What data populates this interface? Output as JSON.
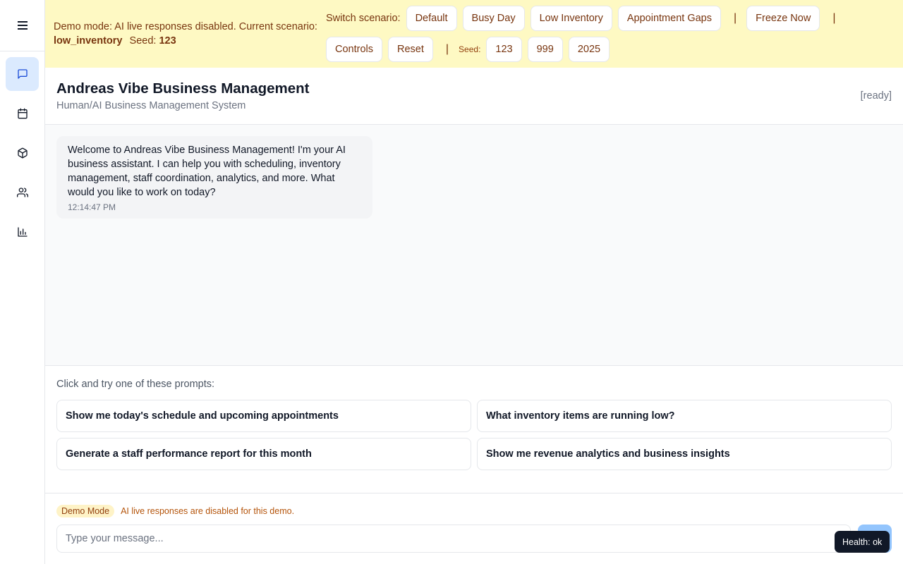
{
  "sidebar": {
    "items": [
      {
        "name": "chat",
        "icon": "message-square-icon",
        "active": true
      },
      {
        "name": "calendar",
        "icon": "calendar-icon",
        "active": false
      },
      {
        "name": "inventory",
        "icon": "package-icon",
        "active": false
      },
      {
        "name": "staff",
        "icon": "users-icon",
        "active": false
      },
      {
        "name": "analytics",
        "icon": "bar-chart-icon",
        "active": false
      }
    ],
    "menu_icon": "menu-icon"
  },
  "banner": {
    "message": "Demo mode: AI live responses disabled. Current scenario:",
    "scenario": "low_inventory",
    "seed_label": "Seed:",
    "seed_value": "123",
    "switch_label": "Switch scenario:",
    "scenarios": [
      "Default",
      "Busy Day",
      "Low Inventory",
      "Appointment Gaps"
    ],
    "freeze_label": "Freeze Now",
    "controls_label": "Controls",
    "reset_label": "Reset",
    "separator": "|",
    "seed_small_label": "Seed:",
    "seeds": [
      "123",
      "999",
      "2025"
    ]
  },
  "header": {
    "title": "Andreas Vibe Business Management",
    "subtitle": "Human/AI Business Management System",
    "status": "[ready]"
  },
  "chat": {
    "messages": [
      {
        "text": "Welcome to Andreas Vibe Business Management! I'm your AI business assistant. I can help you with scheduling, inventory management, staff coordination, analytics, and more. What would you like to work on today?",
        "time": "12:14:47 PM"
      }
    ]
  },
  "prompts": {
    "label": "Click and try one of these prompts:",
    "items": [
      "Show me today's schedule and upcoming appointments",
      "What inventory items are running low?",
      "Generate a staff performance report for this month",
      "Show me revenue analytics and business insights"
    ]
  },
  "footer": {
    "badge": "Demo Mode",
    "note": "AI live responses are disabled for this demo.",
    "input_placeholder": "Type your message..."
  },
  "health": "Health: ok",
  "colors": {
    "banner_bg": "#fef9c3",
    "banner_text": "#78350f",
    "active_nav_bg": "#dbeafe",
    "accent": "#1d4ed8"
  }
}
